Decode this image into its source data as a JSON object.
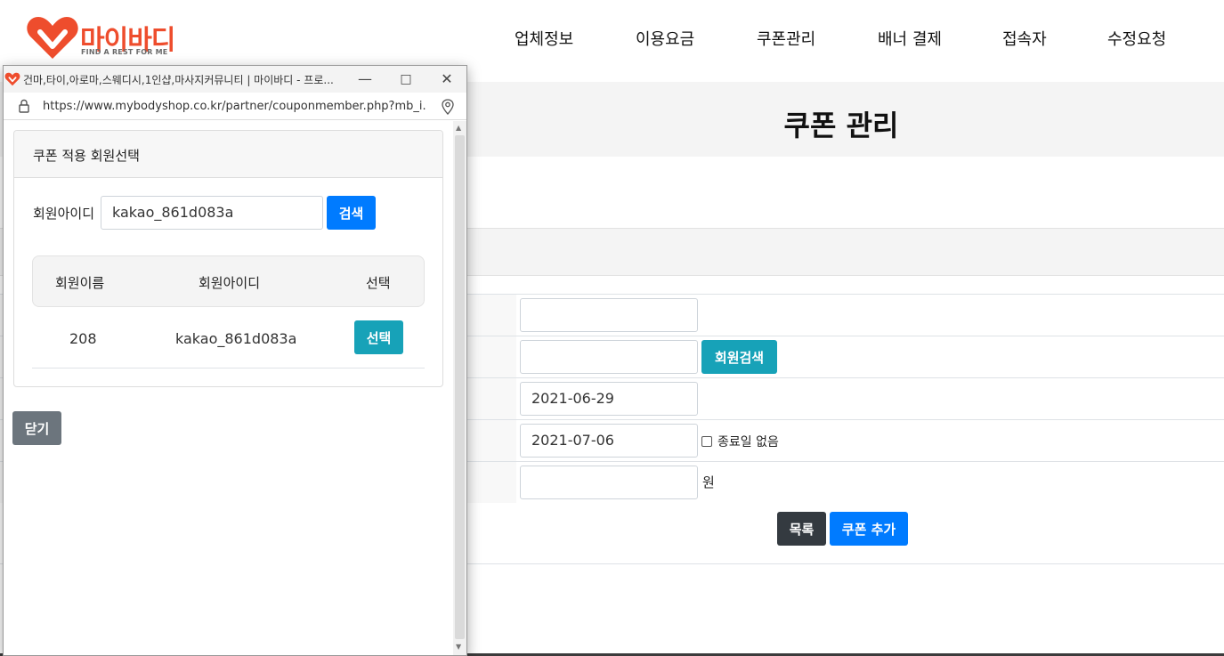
{
  "colors": {
    "brand": "#ee4d2d",
    "primary": "#007bff",
    "info": "#17a2b8",
    "dark": "#343a40",
    "secondary": "#6c757d"
  },
  "logo": {
    "text": "마이바디",
    "tagline": "FIND A REST FOR ME"
  },
  "nav": [
    "업체정보",
    "이용요금",
    "쿠폰관리",
    "배너 결제",
    "접속자",
    "수정요청"
  ],
  "page": {
    "title": "쿠폰 관리"
  },
  "form": {
    "row2_button": "회원검색",
    "start_date": "2021-06-29",
    "end_date": "2021-07-06",
    "no_end_label": "종료일 없음",
    "unit_label": "원",
    "list_button": "목록",
    "add_button": "쿠폰 추가"
  },
  "popup": {
    "window_title": "건마,타이,아로마,스웨디시,1인샵,마사지커뮤니티 | 마이바디 - 프로...",
    "url": "https://www.mybodyshop.co.kr/partner/couponmember.php?mb_i...",
    "card_title": "쿠폰 적용 회원선택",
    "search_label": "회원아이디",
    "search_value": "kakao_861d083a",
    "search_button": "검색",
    "columns": [
      "회원이름",
      "회원아이디",
      "선택"
    ],
    "rows": [
      {
        "name": "208",
        "id": "kakao_861d083a",
        "action": "선택"
      }
    ],
    "close_button": "닫기"
  }
}
